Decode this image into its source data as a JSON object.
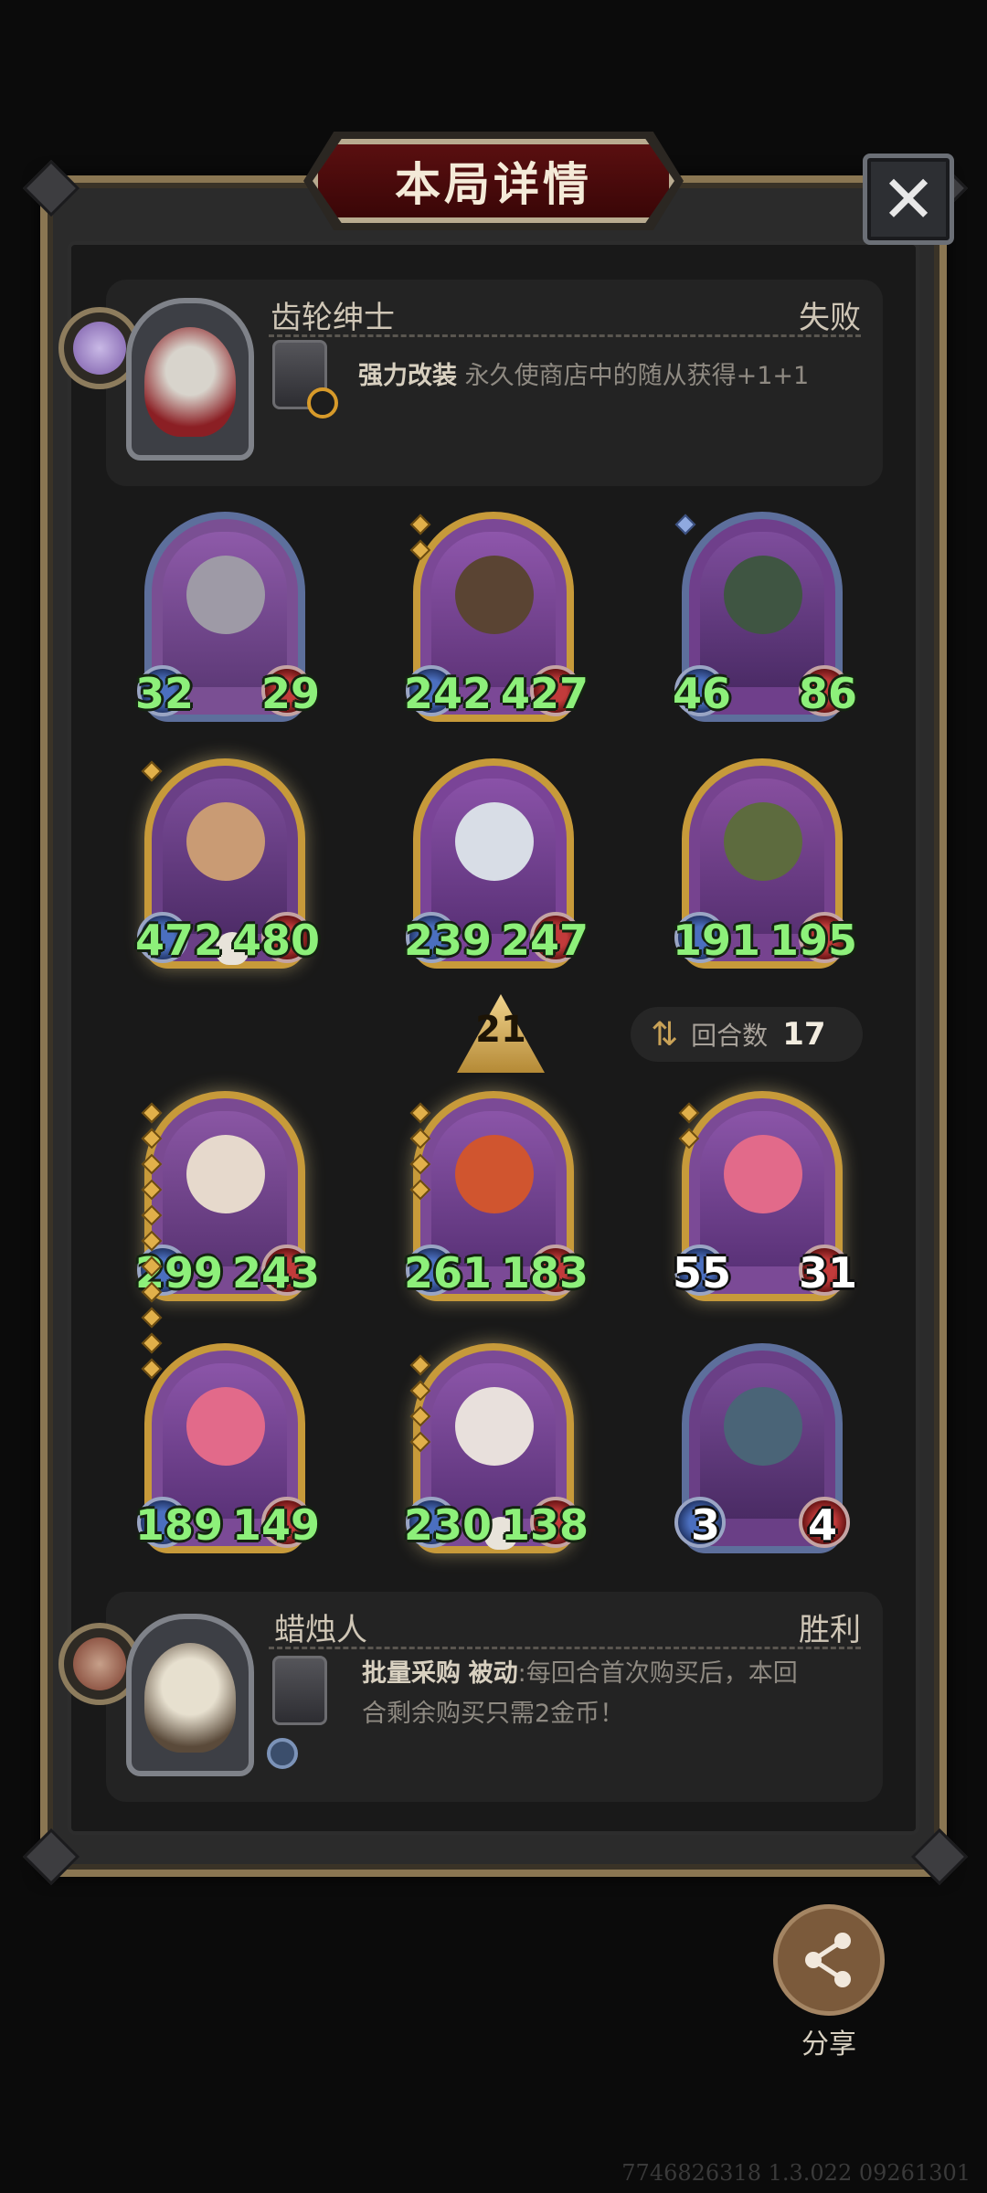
{
  "title": "本局详情",
  "close_icon": "close-icon",
  "opponent": {
    "name": "齿轮绅士",
    "result": "失败",
    "skill_name": "强力改装",
    "skill_desc": "永久使商店中的随从获得+1+1"
  },
  "opponent_minions": [
    {
      "attack": "32",
      "health": "29"
    },
    {
      "attack": "242",
      "health": "427"
    },
    {
      "attack": "46",
      "health": "86"
    },
    {
      "attack": "472",
      "health": "480"
    },
    {
      "attack": "239",
      "health": "247"
    },
    {
      "attack": "191",
      "health": "195"
    }
  ],
  "tier": "21",
  "turns": {
    "label": "回合数",
    "value": "17"
  },
  "player_minions": [
    {
      "attack": "299",
      "health": "243"
    },
    {
      "attack": "261",
      "health": "183"
    },
    {
      "attack": "55",
      "health": "31"
    },
    {
      "attack": "189",
      "health": "149"
    },
    {
      "attack": "230",
      "health": "138"
    },
    {
      "attack": "3",
      "health": "4"
    }
  ],
  "player": {
    "name": "蜡烛人",
    "result": "胜利",
    "skill_name": "批量采购",
    "skill_tag": "被动",
    "skill_desc_line1": ":每回合首次购买后，本回",
    "skill_desc_line2": "合剩余购买只需2金币！"
  },
  "share": {
    "label": "分享"
  },
  "footer": "7746826318 1.3.022 09261301",
  "colors": {
    "stat_green": "#8df07a",
    "frame_gold": "#8a7652",
    "banner_red": "#5a0f10"
  }
}
